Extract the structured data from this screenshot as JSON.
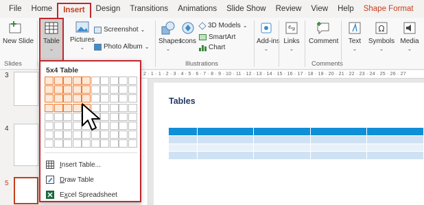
{
  "menu": {
    "tabs": [
      "File",
      "Home",
      "Insert",
      "Design",
      "Transitions",
      "Animations",
      "Slide Show",
      "Review",
      "View",
      "Help",
      "Shape Format"
    ],
    "active_tab": "Insert"
  },
  "ribbon": {
    "new_slide": "New Slide",
    "new_slide_caret": "⌄",
    "table": "Table",
    "pictures": "Pictures",
    "screenshot": "Screenshot",
    "photo_album": "Photo Album",
    "shapes": "Shapes",
    "icons": "Icons",
    "models_3d": "3D Models",
    "smartart": "SmartArt",
    "chart": "Chart",
    "addins": "Add-ins",
    "links": "Links",
    "comment": "Comment",
    "text": "Text",
    "symbols": "Symbols",
    "media": "Media",
    "groups": {
      "slides": "Slides",
      "illustrations": "Illustrations",
      "comments": "Comments"
    }
  },
  "dropdown": {
    "title": "5x4 Table",
    "grid": {
      "cols": 10,
      "rows": 8,
      "selected_cols": 5,
      "selected_rows": 4
    },
    "items": {
      "insert_table_u": "I",
      "insert_table_rest": "nsert Table...",
      "draw_table_u": "D",
      "draw_table_rest": "raw Table",
      "excel_u": "x",
      "excel_pre": "E",
      "excel_rest": "cel Spreadsheet"
    }
  },
  "panel": {
    "slide_numbers": [
      "3",
      "4",
      "5"
    ],
    "active_slide": "5"
  },
  "ruler": {
    "text": "2 · 1 · 1 · 2 · 3 · 4 · 5 · 6 · 7 · 8 · 9 · 10 · 11 · 12 · 13 · 14 · 15 · 16 · 17 · 18 · 19 · 20 · 21 · 22 · 23 · 24 · 25 · 26 · 27"
  },
  "slide": {
    "title": "Tables"
  },
  "colors": {
    "accent": "#c0262d",
    "table_header": "#0f8fd8",
    "grid_selected": "#ed7d31",
    "title": "#1f3864"
  }
}
